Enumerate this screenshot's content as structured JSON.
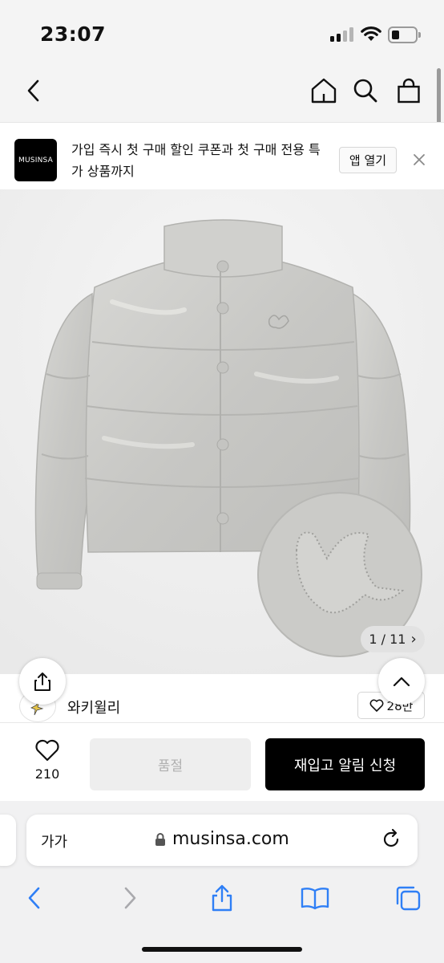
{
  "status_bar": {
    "time": "23:07"
  },
  "nav": {
    "back_icon": "chevron-left-icon",
    "home_icon": "home-icon",
    "search_icon": "search-icon",
    "cart_icon": "shopping-bag-icon"
  },
  "app_banner": {
    "logo_text": "MUSINSA",
    "message": "가입 즉시 첫 구매 할인 쿠폰과 첫 구매 전용 특가 상품까지",
    "open_app_label": "앱 열기",
    "close_icon": "close-icon"
  },
  "product_image": {
    "pager": "1 / 11",
    "pager_arrow": "›"
  },
  "brand": {
    "name": "와키윌리",
    "likes": "28만"
  },
  "purchase": {
    "wish_count": "210",
    "soldout_label": "품절",
    "restock_label": "재입고 알림 신청"
  },
  "browser": {
    "text_size_label": "가가",
    "url": "musinsa.com"
  },
  "colors": {
    "accent": "#000000",
    "soldout_bg": "#eeeeee",
    "safari_blue": "#2f7ff6"
  }
}
